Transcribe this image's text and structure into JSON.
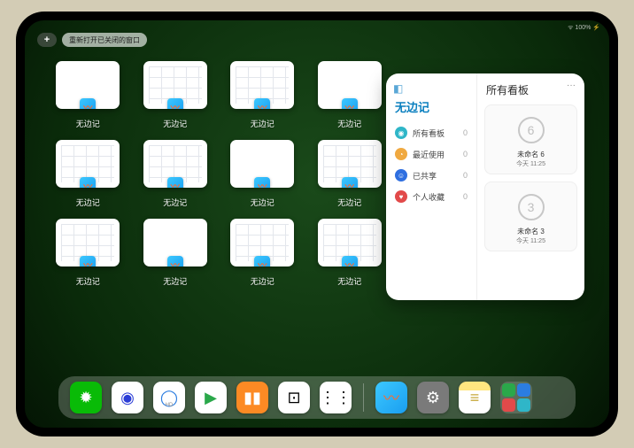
{
  "status": {
    "text": "ᯤ 100% ⚡"
  },
  "toolbar": {
    "plus_label": "+",
    "reopen_label": "重新打开已关闭的窗口"
  },
  "app_grid": {
    "app_name": "无边记",
    "items": [
      {
        "label": "无边记",
        "variant": "blank"
      },
      {
        "label": "无边记",
        "variant": "grid"
      },
      {
        "label": "无边记",
        "variant": "grid"
      },
      {
        "label": "无边记",
        "variant": "blank"
      },
      {
        "label": "无边记",
        "variant": "grid"
      },
      {
        "label": "无边记",
        "variant": "grid"
      },
      {
        "label": "无边记",
        "variant": "blank"
      },
      {
        "label": "无边记",
        "variant": "grid"
      },
      {
        "label": "无边记",
        "variant": "grid"
      },
      {
        "label": "无边记",
        "variant": "blank"
      },
      {
        "label": "无边记",
        "variant": "grid"
      },
      {
        "label": "无边记",
        "variant": "grid"
      }
    ]
  },
  "panel": {
    "app_title": "无边记",
    "right_title": "所有看板",
    "more": "···",
    "filters": [
      {
        "icon": "◉",
        "color": "#2fb6c8",
        "label": "所有看板",
        "count": "0"
      },
      {
        "icon": "◔",
        "color": "#f0a940",
        "label": "最近使用",
        "count": "0"
      },
      {
        "icon": "☺",
        "color": "#2f6fe0",
        "label": "已共享",
        "count": "0"
      },
      {
        "icon": "♥",
        "color": "#e24a4a",
        "label": "个人收藏",
        "count": "0"
      }
    ],
    "boards": [
      {
        "glyph": "6",
        "name": "未命名 6",
        "time": "今天 11:25"
      },
      {
        "glyph": "3",
        "name": "未命名 3",
        "time": "今天 11:25"
      }
    ]
  },
  "dock": {
    "items": [
      {
        "name": "wechat-icon",
        "bg": "#09bb07",
        "glyph": "✹"
      },
      {
        "name": "browser1-icon",
        "bg": "#ffffff",
        "glyph": "◉",
        "fg": "#2b3dd6"
      },
      {
        "name": "browser2-icon",
        "bg": "#ffffff",
        "glyph": "◯",
        "fg": "#2b7de0",
        "sub": "HD"
      },
      {
        "name": "play-icon",
        "bg": "#ffffff",
        "glyph": "▶",
        "fg": "#2aa84a"
      },
      {
        "name": "books-icon",
        "bg": "#fc8a24",
        "glyph": "▮▮"
      },
      {
        "name": "dice-icon",
        "bg": "#ffffff",
        "glyph": "⊡",
        "fg": "#000"
      },
      {
        "name": "nodes-icon",
        "bg": "#ffffff",
        "glyph": "⋮⋮",
        "fg": "#000"
      }
    ],
    "recent": [
      {
        "name": "freeform-icon",
        "bg": "linear-gradient(135deg,#3cc8ff,#1a9ef0)",
        "glyph": "〰",
        "fg": "#ff6a2b"
      },
      {
        "name": "settings-icon",
        "bg": "#7a7a7a",
        "glyph": "⚙"
      },
      {
        "name": "notes-icon",
        "bg": "linear-gradient(#ffe680 28%,#fff 28%)",
        "glyph": "≡",
        "fg": "#c7a83a"
      }
    ],
    "app_library": {
      "name": "app-library-icon"
    }
  }
}
